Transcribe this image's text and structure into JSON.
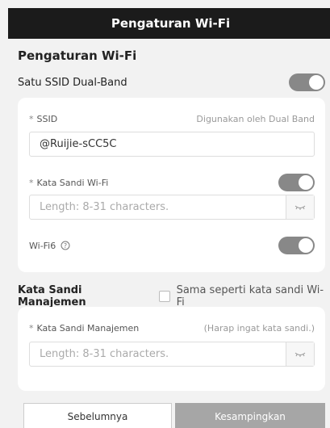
{
  "header": {
    "title": "Pengaturan Wi-Fi"
  },
  "section": {
    "title": "Pengaturan Wi-Fi"
  },
  "dual_band": {
    "label": "Satu SSID Dual-Band",
    "enabled": true
  },
  "ssid": {
    "required_mark": "*",
    "label": "SSID",
    "hint": "Digunakan oleh Dual Band",
    "value": "@Ruijie-sCC5C"
  },
  "wifi_password": {
    "required_mark": "*",
    "label": "Kata Sandi Wi-Fi",
    "enabled": true,
    "placeholder": "Length: 8-31 characters.",
    "value": ""
  },
  "wifi6": {
    "label": "Wi-Fi6",
    "help_icon": "question-circle-icon",
    "enabled": true
  },
  "management": {
    "title": "Kata Sandi Manajemen",
    "same_as_wifi_label": "Sama seperti kata sandi Wi-Fi",
    "same_as_wifi_checked": false,
    "password_required_mark": "*",
    "password_label": "Kata Sandi Manajemen",
    "password_hint": "(Harap ingat kata sandi.)",
    "password_placeholder": "Length: 8-31 characters.",
    "password_value": ""
  },
  "buttons": {
    "previous": "Sebelumnya",
    "skip": "Kesampingkan"
  },
  "colors": {
    "header_bg": "#1b1b1b",
    "toggle_on": "#888888",
    "skip_button": "#a6a6a6"
  },
  "icons": {
    "eye": "eye-closed-icon",
    "help": "question-circle-icon"
  }
}
